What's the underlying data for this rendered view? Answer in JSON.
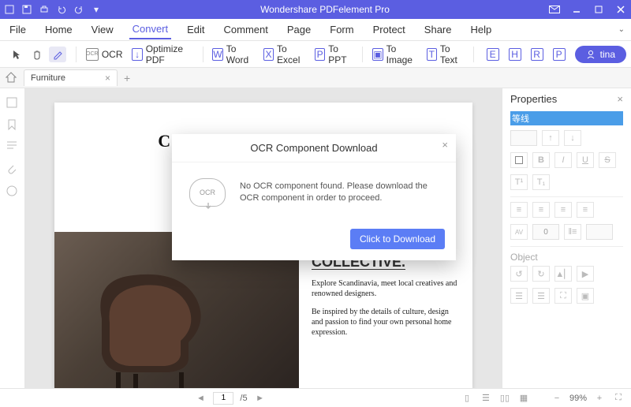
{
  "app": {
    "title": "Wondershare PDFelement Pro",
    "user": "tina"
  },
  "menu": {
    "items": [
      "File",
      "Home",
      "View",
      "Convert",
      "Edit",
      "Comment",
      "Page",
      "Form",
      "Protect",
      "Share",
      "Help"
    ],
    "active": "Convert"
  },
  "toolbar": {
    "ocr": "OCR",
    "optimize": "Optimize PDF",
    "toword": "To Word",
    "toexcel": "To Excel",
    "toppt": "To PPT",
    "toimage": "To Image",
    "totext": "To Text"
  },
  "tab": {
    "name": "Furniture"
  },
  "document": {
    "title": "COLUMBIA",
    "subtitle_partial": "C",
    "heading": "INSPIRED BY THE COLLECTIVE.",
    "para1": "Explore Scandinavia, meet local creatives and renowned designers.",
    "para2": "Be inspired by the details of culture, design and passion to find your own personal home expression."
  },
  "dialog": {
    "title": "OCR Component Download",
    "icon_label": "OCR",
    "message": "No OCR component found. Please download the OCR component in order to proceed.",
    "button": "Click to Download"
  },
  "props": {
    "title": "Properties",
    "selected_text": "等线",
    "object_label": "Object",
    "spacing_value": "0"
  },
  "status": {
    "page_current": "1",
    "page_total": "/5",
    "zoom": "99%"
  }
}
